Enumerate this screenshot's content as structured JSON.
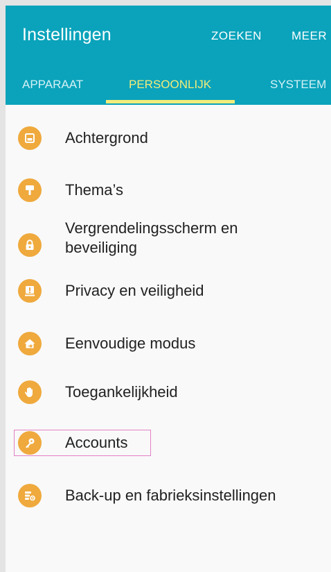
{
  "header": {
    "title": "Instellingen",
    "actions": {
      "search": "ZOEKEN",
      "more": "MEER"
    }
  },
  "tabs": [
    {
      "label": "APPARAAT",
      "selected": false
    },
    {
      "label": "PERSOONLIJK",
      "selected": true
    },
    {
      "label": "SYSTEEM",
      "selected": false
    }
  ],
  "colors": {
    "appbar": "#0aa3bb",
    "tab_active": "#f3ec7a",
    "icon_bg": "#efa93d",
    "highlight_border": "#e47fc5"
  },
  "settings": [
    {
      "label": "Achtergrond",
      "icon": "wallpaper-icon"
    },
    {
      "label": "Thema’s",
      "icon": "paint-roller-icon"
    },
    {
      "label": "Vergrendelingsscherm en beveiliging",
      "line1": "Vergrendelingsscherm en",
      "line2": "beveiliging",
      "icon": "lock-icon"
    },
    {
      "label": "Privacy en veiligheid",
      "icon": "privacy-alert-icon"
    },
    {
      "label": "Eenvoudige modus",
      "icon": "easy-mode-home-icon"
    },
    {
      "label": "Toegankelijkheid",
      "icon": "hand-icon"
    },
    {
      "label": "Accounts",
      "icon": "key-icon",
      "highlighted": true
    },
    {
      "label": "Back-up en fabrieksinstellingen",
      "icon": "backup-restore-icon"
    }
  ]
}
